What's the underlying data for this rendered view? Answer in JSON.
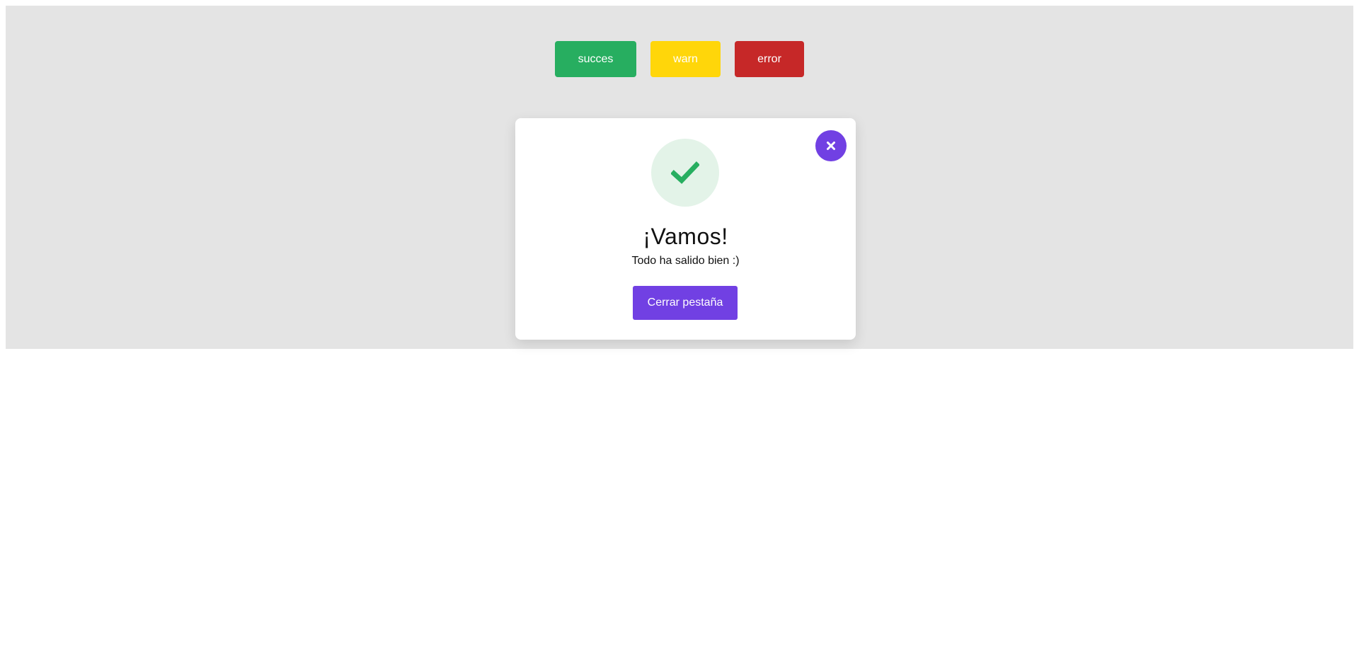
{
  "colors": {
    "page_background": "#e4e4e4",
    "success": "#27ae60",
    "warn": "#ffd60a",
    "error": "#c62828",
    "accent": "#7140e3",
    "success_tint": "#e3f3e8"
  },
  "toolbar": {
    "success_label": "succes",
    "warn_label": "warn",
    "error_label": "error"
  },
  "modal": {
    "status_icon": "check-icon",
    "close_icon": "close-icon",
    "title": "¡Vamos!",
    "message": "Todo ha salido bien :)",
    "action_label": "Cerrar pestaña"
  }
}
